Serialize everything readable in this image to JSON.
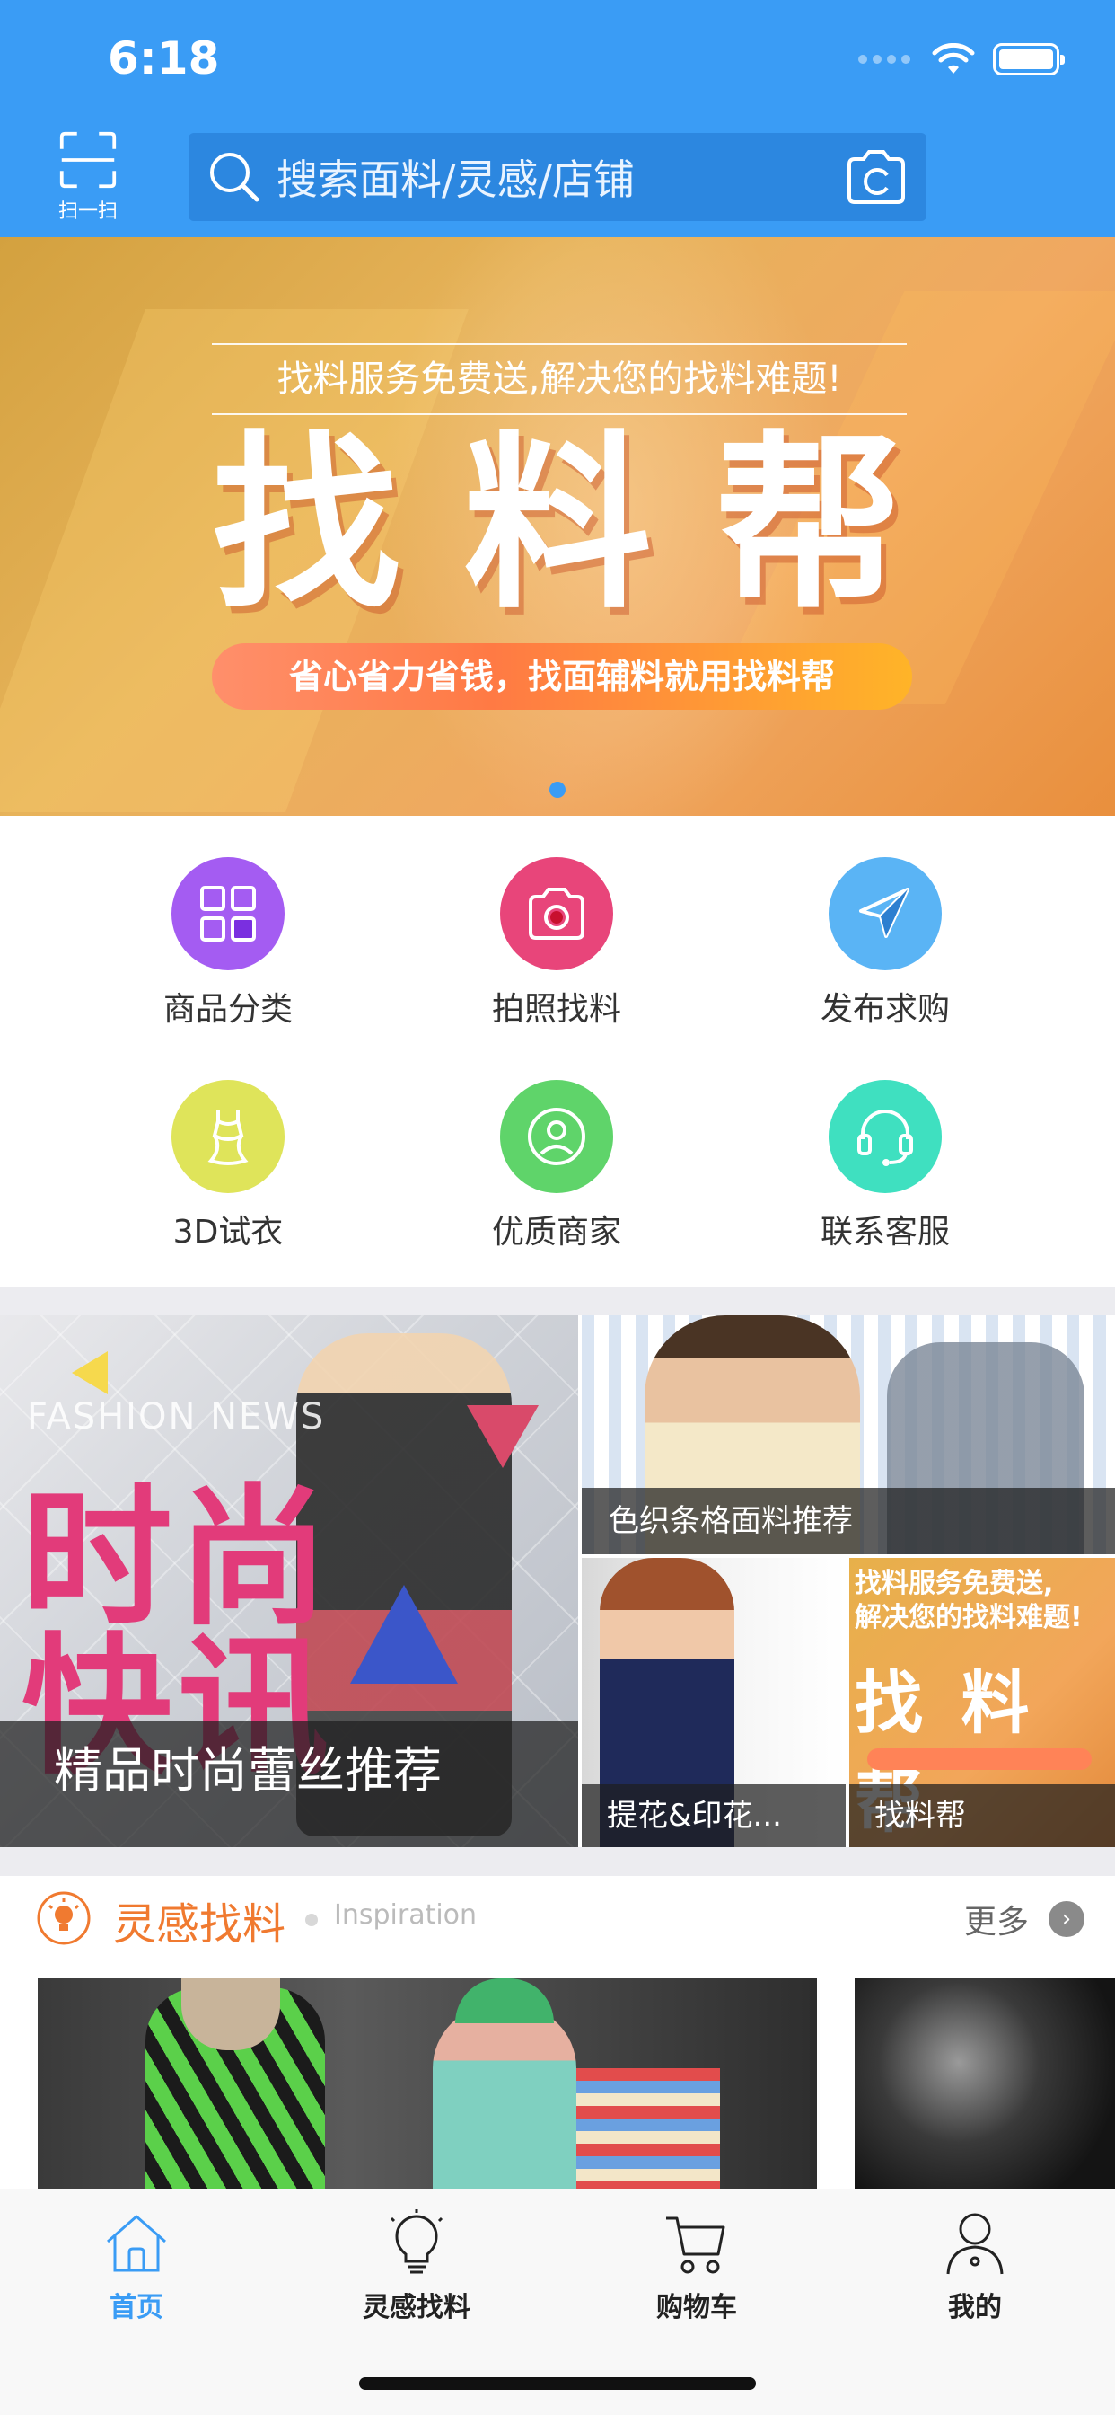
{
  "status": {
    "time": "6:18"
  },
  "header": {
    "scan_label": "扫一扫",
    "search_placeholder": "搜索面料/灵感/店铺"
  },
  "banner": {
    "subtitle": "找料服务免费送,解决您的找料难题!",
    "title": "找料帮",
    "slogan": "省心省力省钱，找面辅料就用找料帮",
    "active_index": 0,
    "total": 1
  },
  "categories": [
    {
      "label": "商品分类",
      "icon": "grid-icon",
      "color": "#a45cf2"
    },
    {
      "label": "拍照找料",
      "icon": "camera-icon",
      "color": "#e8457a"
    },
    {
      "label": "发布求购",
      "icon": "paper-plane-icon",
      "color": "#5ab4f5"
    },
    {
      "label": "3D试衣",
      "icon": "dress-icon",
      "color": "#dfe45a"
    },
    {
      "label": "优质商家",
      "icon": "merchant-icon",
      "color": "#5fd46a"
    },
    {
      "label": "联系客服",
      "icon": "headset-icon",
      "color": "#3fe0c0"
    }
  ],
  "promos": {
    "big": {
      "overlay_text": "FASHION NEWS",
      "headline_1": "时尚",
      "headline_2": "快讯",
      "caption": "精品时尚蕾丝推荐"
    },
    "top_right": {
      "caption": "色织条格面料推荐"
    },
    "bottom_left": {
      "caption": "提花&印花..."
    },
    "bottom_right": {
      "line1": "找料服务免费送,",
      "line2": "解决您的找料难题!",
      "title": "找 料 帮",
      "caption": "找料帮"
    }
  },
  "inspiration": {
    "title": "灵感找料",
    "subtitle": "Inspiration",
    "more_label": "更多",
    "accent": "#f07a30"
  },
  "tabbar": {
    "tabs": [
      {
        "label": "首页",
        "icon": "home-icon",
        "active": true
      },
      {
        "label": "灵感找料",
        "icon": "lightbulb-icon",
        "active": false
      },
      {
        "label": "购物车",
        "icon": "cart-icon",
        "active": false
      },
      {
        "label": "我的",
        "icon": "user-icon",
        "active": false
      }
    ],
    "active_color": "#3a9cf5"
  },
  "colors": {
    "primary": "#3a9cf5",
    "search_bg": "#2c87e0"
  }
}
